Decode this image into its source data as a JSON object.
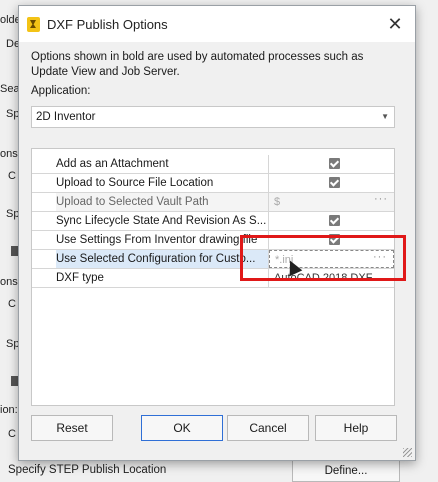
{
  "background": {
    "left_labels": [
      "olde",
      "De",
      "Sea",
      "Sp",
      "ons",
      "C",
      "Sp",
      "ons",
      "C",
      "Sp",
      "ion:",
      "C"
    ],
    "bottom_label": "Specify STEP Publish Location",
    "define_button": "Define..."
  },
  "dialog": {
    "title": "DXF Publish Options",
    "close_glyph": "✕",
    "description": "Options shown in bold are used by automated processes such as Update View and Job Server.",
    "application_label": "Application:",
    "application_value": "2D Inventor",
    "dropdown_glyph": "▼",
    "rows": [
      {
        "label": "Add as an Attachment",
        "value": "checked"
      },
      {
        "label": "Upload to Source File Location",
        "value": "checked"
      },
      {
        "label": "Upload to Selected Vault Path",
        "value": "$"
      },
      {
        "label": "Sync Lifecycle State And Revision As S...",
        "value": "checked"
      },
      {
        "label": "Use Settings From Inventor drawing file",
        "value": "checked"
      },
      {
        "label": "Use Selected Configuration for Custo...",
        "value": "*.ini"
      },
      {
        "label": "DXF type",
        "value": "AutoCAD 2018 DXF"
      }
    ],
    "ellipsis": "···",
    "buttons": {
      "reset": "Reset",
      "ok": "OK",
      "cancel": "Cancel",
      "help": "Help"
    }
  }
}
